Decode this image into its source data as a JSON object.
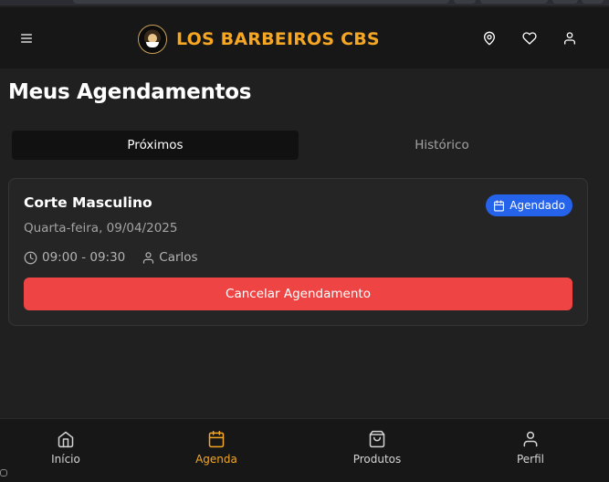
{
  "header": {
    "brand_name": "LOS BARBEIROS CBS",
    "menu_icon": "menu-icon",
    "actions": [
      "location-icon",
      "heart-icon",
      "user-icon"
    ]
  },
  "page": {
    "title": "Meus Agendamentos"
  },
  "tabs": [
    {
      "label": "Próximos",
      "active": true
    },
    {
      "label": "Histórico",
      "active": false
    }
  ],
  "appointment": {
    "service": "Corte Masculino",
    "date": "Quarta-feira, 09/04/2025",
    "status": "Agendado",
    "time": "09:00 - 09:30",
    "barber": "Carlos",
    "cancel_label": "Cancelar Agendamento"
  },
  "bottom_nav": [
    {
      "label": "Início",
      "icon": "home-icon",
      "active": false
    },
    {
      "label": "Agenda",
      "icon": "calendar-icon",
      "active": true
    },
    {
      "label": "Produtos",
      "icon": "shopping-bag-icon",
      "active": false
    },
    {
      "label": "Perfil",
      "icon": "user-icon",
      "active": false
    }
  ],
  "colors": {
    "accent": "#f5a623",
    "badge": "#2563eb",
    "danger": "#ef4444",
    "background": "#202020",
    "header": "#171717"
  }
}
